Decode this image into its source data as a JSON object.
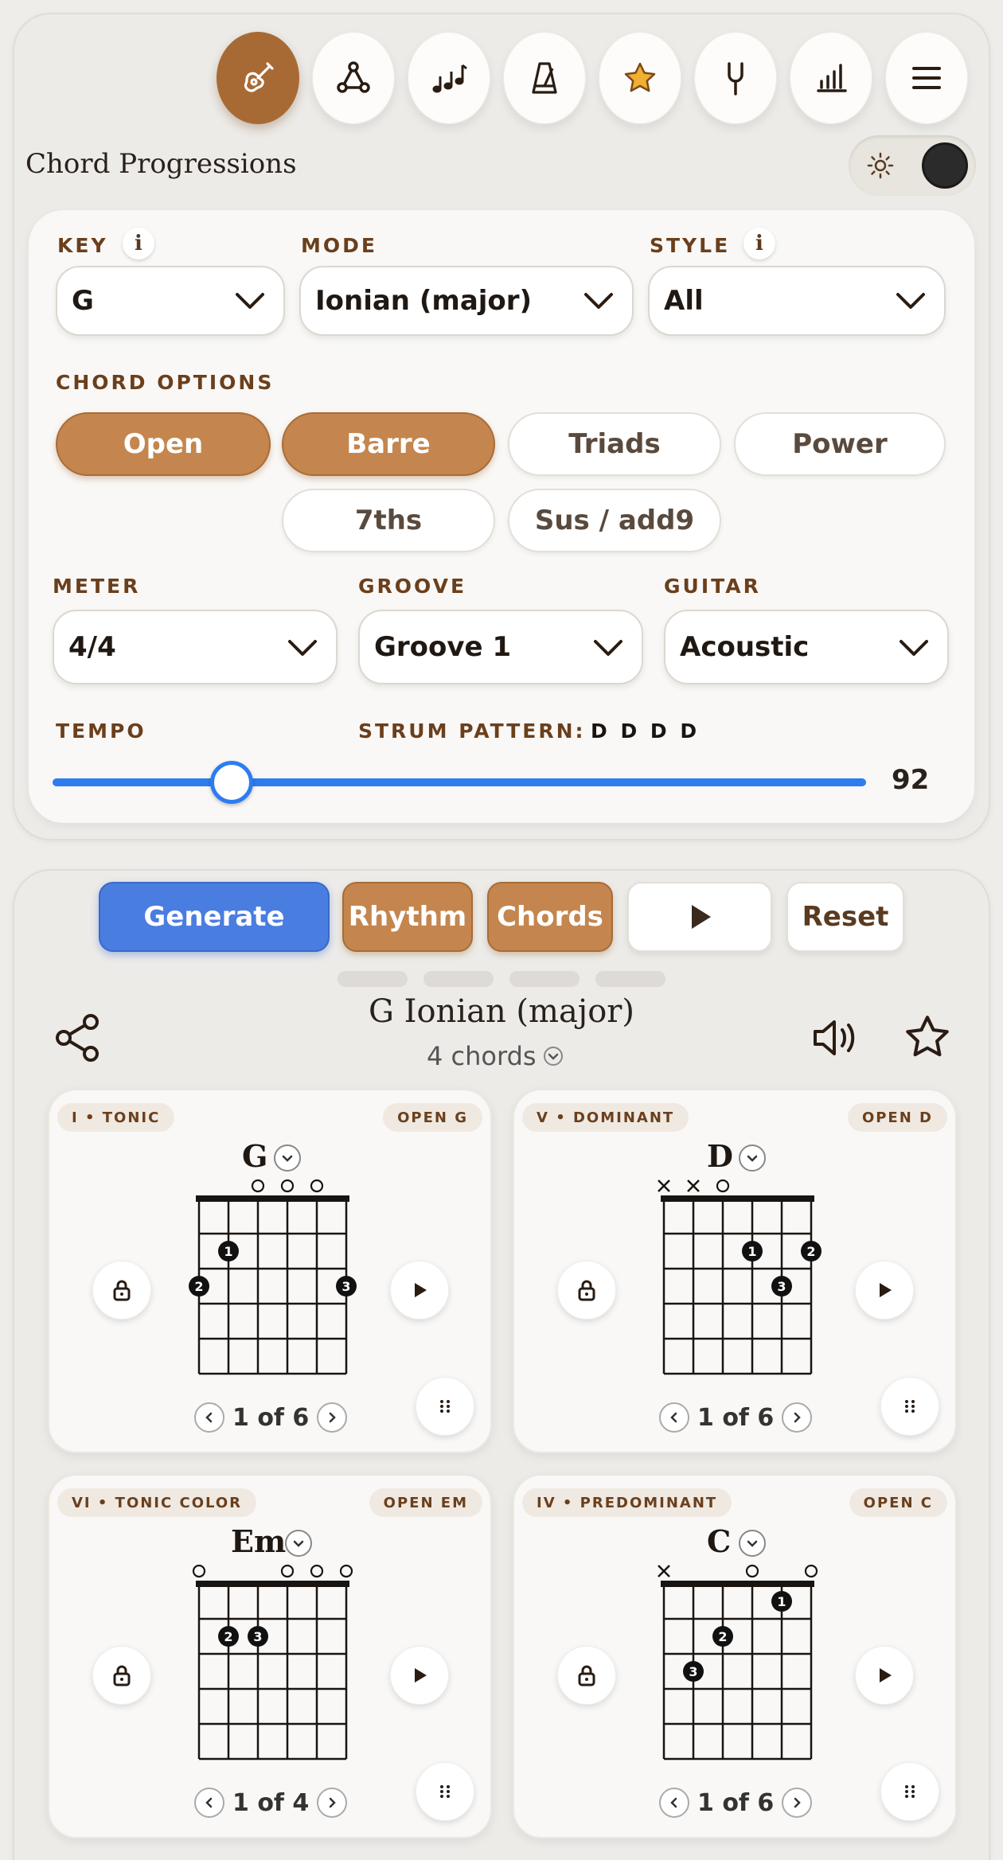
{
  "nav": {
    "items": [
      {
        "icon": "guitar-icon",
        "active": true
      },
      {
        "icon": "triangle-nodes-icon",
        "active": false
      },
      {
        "icon": "music-notes-icon",
        "active": false
      },
      {
        "icon": "metronome-icon",
        "active": false
      },
      {
        "icon": "star-icon",
        "active": false
      },
      {
        "icon": "tuning-fork-icon",
        "active": false
      },
      {
        "icon": "bar-chart-icon",
        "active": false
      },
      {
        "icon": "menu-icon",
        "active": false
      }
    ]
  },
  "page": {
    "title": "Chord Progressions"
  },
  "settings": {
    "key": {
      "label": "KEY",
      "value": "G"
    },
    "mode": {
      "label": "MODE",
      "value": "Ionian (major)"
    },
    "style": {
      "label": "STYLE",
      "value": "All"
    },
    "chord_options": {
      "label": "CHORD OPTIONS",
      "chips": [
        {
          "label": "Open",
          "selected": true
        },
        {
          "label": "Barre",
          "selected": true
        },
        {
          "label": "Triads",
          "selected": false
        },
        {
          "label": "Power",
          "selected": false
        },
        {
          "label": "7ths",
          "selected": false
        },
        {
          "label": "Sus / add9",
          "selected": false
        }
      ]
    },
    "meter": {
      "label": "METER",
      "value": "4/4"
    },
    "groove": {
      "label": "GROOVE",
      "value": "Groove 1"
    },
    "guitar": {
      "label": "GUITAR",
      "value": "Acoustic"
    },
    "tempo": {
      "label": "TEMPO",
      "value": "92",
      "fraction": 0.22
    },
    "strum": {
      "label": "STRUM PATTERN:",
      "value": "D D D D"
    }
  },
  "actions": {
    "generate": "Generate",
    "rhythm": "Rhythm",
    "chords": "Chords",
    "reset": "Reset"
  },
  "progression": {
    "title": "G Ionian (major)",
    "count": "4 chords",
    "chords": [
      {
        "function": "I • TONIC",
        "voicing": "OPEN G",
        "name": "G",
        "pager": "1 of 6",
        "top": [
          "",
          "",
          "o",
          "o",
          "o",
          ""
        ],
        "dots": [
          {
            "s": 1,
            "f": 3,
            "n": "2"
          },
          {
            "s": 2,
            "f": 2,
            "n": "1"
          },
          {
            "s": 6,
            "f": 3,
            "n": "3"
          }
        ]
      },
      {
        "function": "V • DOMINANT",
        "voicing": "OPEN D",
        "name": "D",
        "pager": "1 of 6",
        "top": [
          "x",
          "x",
          "o",
          "",
          "",
          ""
        ],
        "dots": [
          {
            "s": 4,
            "f": 2,
            "n": "1"
          },
          {
            "s": 6,
            "f": 2,
            "n": "2"
          },
          {
            "s": 5,
            "f": 3,
            "n": "3"
          }
        ]
      },
      {
        "function": "VI • TONIC COLOR",
        "voicing": "OPEN EM",
        "name": "Em",
        "pager": "1 of 4",
        "top": [
          "o",
          "",
          "",
          "o",
          "o",
          "o"
        ],
        "dots": [
          {
            "s": 2,
            "f": 2,
            "n": "2"
          },
          {
            "s": 3,
            "f": 2,
            "n": "3"
          }
        ]
      },
      {
        "function": "IV • PREDOMINANT",
        "voicing": "OPEN C",
        "name": "C",
        "pager": "1 of 6",
        "top": [
          "x",
          "",
          "",
          "o",
          "",
          "o"
        ],
        "dots": [
          {
            "s": 5,
            "f": 1,
            "n": "1"
          },
          {
            "s": 3,
            "f": 2,
            "n": "2"
          },
          {
            "s": 2,
            "f": 3,
            "n": "3"
          }
        ]
      }
    ]
  },
  "colors": {
    "accent": "#a86a34",
    "chip_on": "#c4864e",
    "primary": "#4a7de0",
    "slider": "#2d7cf0"
  }
}
